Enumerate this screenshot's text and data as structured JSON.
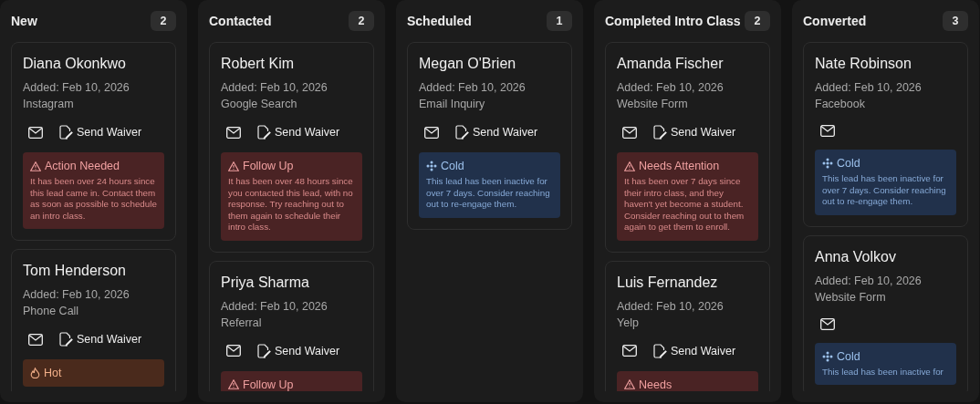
{
  "columns": [
    {
      "title": "New",
      "count": "2",
      "leads": [
        {
          "name": "Diana Okonkwo",
          "added": "Added: Feb 10, 2026",
          "source": "Instagram",
          "send_waiver": "Send Waiver",
          "alert": {
            "kind": "warning",
            "title": "Action Needed",
            "text": "It has been over 24 hours since this lead came in. Contact them as soon as possible to schedule an intro class."
          }
        },
        {
          "name": "Tom Henderson",
          "added": "Added: Feb 10, 2026",
          "source": "Phone Call",
          "send_waiver": "Send Waiver",
          "alert": {
            "kind": "hot",
            "title": "Hot"
          }
        }
      ]
    },
    {
      "title": "Contacted",
      "count": "2",
      "leads": [
        {
          "name": "Robert Kim",
          "added": "Added: Feb 10, 2026",
          "source": "Google Search",
          "send_waiver": "Send Waiver",
          "alert": {
            "kind": "warning",
            "title": "Follow Up",
            "text": "It has been over 48 hours since you contacted this lead, with no response. Try reaching out to them again to schedule their intro class."
          }
        },
        {
          "name": "Priya Sharma",
          "added": "Added: Feb 10, 2026",
          "source": "Referral",
          "send_waiver": "Send Waiver",
          "alert": {
            "kind": "warning",
            "title": "Follow Up"
          }
        }
      ]
    },
    {
      "title": "Scheduled",
      "count": "1",
      "leads": [
        {
          "name": "Megan O'Brien",
          "added": "Added: Feb 10, 2026",
          "source": "Email Inquiry",
          "send_waiver": "Send Waiver",
          "alert": {
            "kind": "cold",
            "title": "Cold",
            "text": "This lead has been inactive for over 7 days. Consider reaching out to re-engage them."
          }
        }
      ]
    },
    {
      "title": "Completed Intro Class",
      "count": "2",
      "leads": [
        {
          "name": "Amanda Fischer",
          "added": "Added: Feb 10, 2026",
          "source": "Website Form",
          "send_waiver": "Send Waiver",
          "alert": {
            "kind": "warning",
            "title": "Needs Attention",
            "text": "It has been over 7 days since their intro class, and they haven't yet become a student. Consider reaching out to them again to get them to enroll."
          }
        },
        {
          "name": "Luis Fernandez",
          "added": "Added: Feb 10, 2026",
          "source": "Yelp",
          "send_waiver": "Send Waiver",
          "alert": {
            "kind": "warning",
            "title": "Needs"
          }
        }
      ]
    },
    {
      "title": "Converted",
      "count": "3",
      "leads": [
        {
          "name": "Nate Robinson",
          "added": "Added: Feb 10, 2026",
          "source": "Facebook",
          "alert": {
            "kind": "cold",
            "title": "Cold",
            "text": "This lead has been inactive for over 7 days. Consider reaching out to re-engage them."
          }
        },
        {
          "name": "Anna Volkov",
          "added": "Added: Feb 10, 2026",
          "source": "Website Form",
          "alert": {
            "kind": "cold",
            "title": "Cold",
            "text": "This lead has been inactive for"
          }
        }
      ]
    }
  ]
}
